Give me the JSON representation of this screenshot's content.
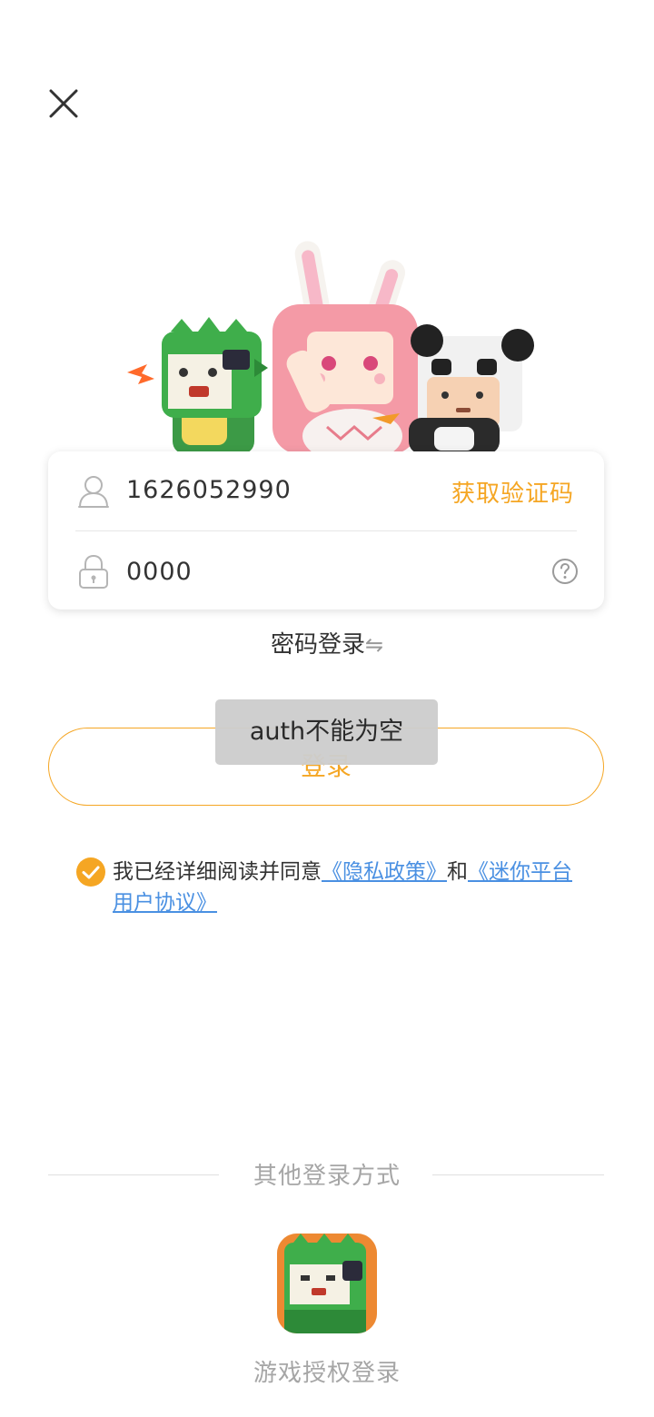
{
  "form": {
    "phone_value": "1626052990",
    "get_code_label": "获取验证码",
    "code_value": "0000"
  },
  "switch_login": {
    "label": "密码登录",
    "arrow": "⇋"
  },
  "login_button": {
    "label": "登录"
  },
  "toast": {
    "message": "auth不能为空"
  },
  "agreement": {
    "checked": true,
    "prefix": "我已经详细阅读并同意",
    "privacy_link": "《隐私政策》",
    "and_text": "和",
    "terms_link": "《迷你平台用户协议》"
  },
  "other_login": {
    "title": "其他登录方式",
    "game_auth_label": "游戏授权登录"
  },
  "colors": {
    "accent": "#f5a623",
    "link": "#4a90e2",
    "muted": "#a6a6a6"
  },
  "icons": {
    "close": "close-icon",
    "user": "user-icon",
    "lock": "lock-icon",
    "help": "help-icon",
    "check": "check-circle-icon"
  }
}
